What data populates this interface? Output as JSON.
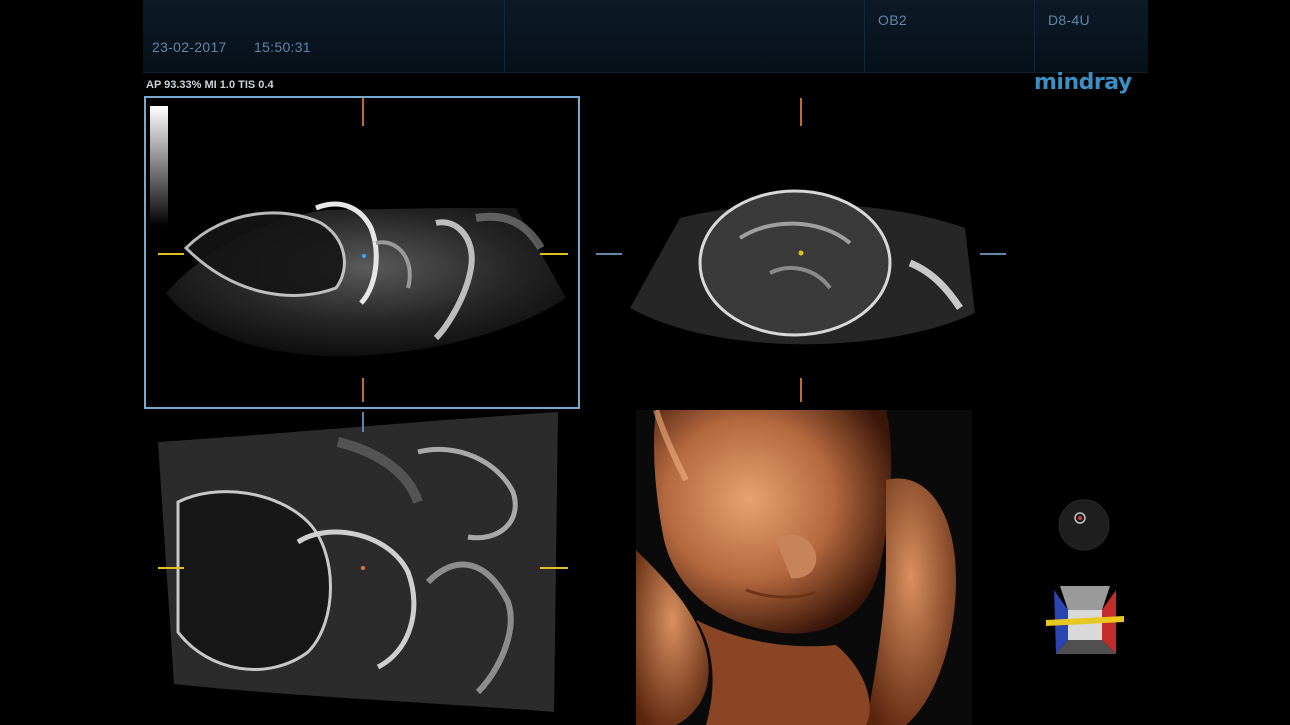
{
  "header": {
    "datetime_date": "23-02-2017",
    "datetime_time": "15:50:31",
    "preset": "OB2",
    "probe": "D8-4U"
  },
  "brand": {
    "logo_text": "mindray"
  },
  "acoustic": {
    "text": "AP 93.33%  MI 1.0 TIS 0.4"
  },
  "views": [
    {
      "id": "plane-a",
      "active": true
    },
    {
      "id": "plane-b",
      "active": false
    },
    {
      "id": "plane-c",
      "active": false
    },
    {
      "id": "render-3d",
      "active": false
    }
  ],
  "colors": {
    "active_border": "#7aa9cf",
    "marker_yellow": "#e0c020",
    "marker_orange": "#c46a2a",
    "skin": "#b7744a"
  },
  "icons": {
    "trackball": "trackball-icon",
    "orientation": "orientation-cube-icon"
  }
}
